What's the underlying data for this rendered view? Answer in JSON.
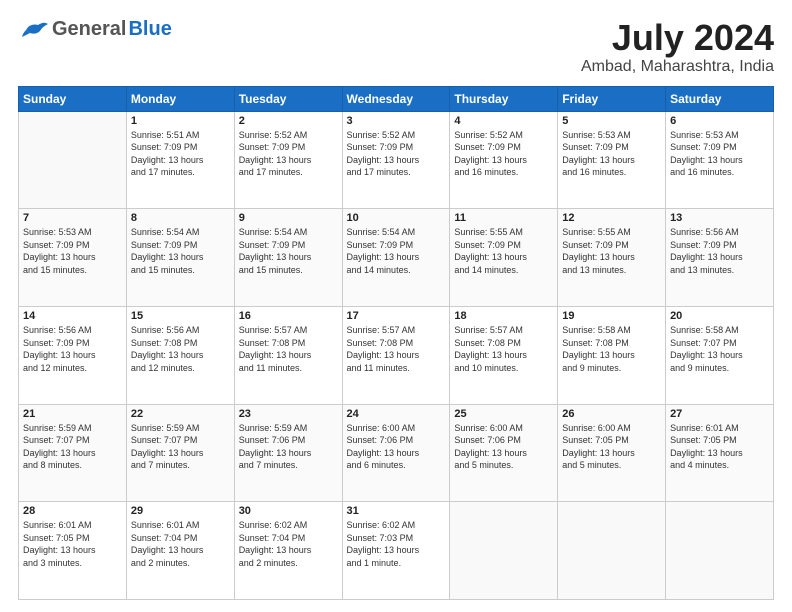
{
  "logo": {
    "general": "General",
    "blue": "Blue"
  },
  "header": {
    "month_year": "July 2024",
    "location": "Ambad, Maharashtra, India"
  },
  "days_of_week": [
    "Sunday",
    "Monday",
    "Tuesday",
    "Wednesday",
    "Thursday",
    "Friday",
    "Saturday"
  ],
  "weeks": [
    [
      {
        "day": "",
        "sunrise": "",
        "sunset": "",
        "daylight": ""
      },
      {
        "day": "1",
        "sunrise": "Sunrise: 5:51 AM",
        "sunset": "Sunset: 7:09 PM",
        "daylight": "Daylight: 13 hours and 17 minutes."
      },
      {
        "day": "2",
        "sunrise": "Sunrise: 5:52 AM",
        "sunset": "Sunset: 7:09 PM",
        "daylight": "Daylight: 13 hours and 17 minutes."
      },
      {
        "day": "3",
        "sunrise": "Sunrise: 5:52 AM",
        "sunset": "Sunset: 7:09 PM",
        "daylight": "Daylight: 13 hours and 17 minutes."
      },
      {
        "day": "4",
        "sunrise": "Sunrise: 5:52 AM",
        "sunset": "Sunset: 7:09 PM",
        "daylight": "Daylight: 13 hours and 16 minutes."
      },
      {
        "day": "5",
        "sunrise": "Sunrise: 5:53 AM",
        "sunset": "Sunset: 7:09 PM",
        "daylight": "Daylight: 13 hours and 16 minutes."
      },
      {
        "day": "6",
        "sunrise": "Sunrise: 5:53 AM",
        "sunset": "Sunset: 7:09 PM",
        "daylight": "Daylight: 13 hours and 16 minutes."
      }
    ],
    [
      {
        "day": "7",
        "sunrise": "Sunrise: 5:53 AM",
        "sunset": "Sunset: 7:09 PM",
        "daylight": "Daylight: 13 hours and 15 minutes."
      },
      {
        "day": "8",
        "sunrise": "Sunrise: 5:54 AM",
        "sunset": "Sunset: 7:09 PM",
        "daylight": "Daylight: 13 hours and 15 minutes."
      },
      {
        "day": "9",
        "sunrise": "Sunrise: 5:54 AM",
        "sunset": "Sunset: 7:09 PM",
        "daylight": "Daylight: 13 hours and 15 minutes."
      },
      {
        "day": "10",
        "sunrise": "Sunrise: 5:54 AM",
        "sunset": "Sunset: 7:09 PM",
        "daylight": "Daylight: 13 hours and 14 minutes."
      },
      {
        "day": "11",
        "sunrise": "Sunrise: 5:55 AM",
        "sunset": "Sunset: 7:09 PM",
        "daylight": "Daylight: 13 hours and 14 minutes."
      },
      {
        "day": "12",
        "sunrise": "Sunrise: 5:55 AM",
        "sunset": "Sunset: 7:09 PM",
        "daylight": "Daylight: 13 hours and 13 minutes."
      },
      {
        "day": "13",
        "sunrise": "Sunrise: 5:56 AM",
        "sunset": "Sunset: 7:09 PM",
        "daylight": "Daylight: 13 hours and 13 minutes."
      }
    ],
    [
      {
        "day": "14",
        "sunrise": "Sunrise: 5:56 AM",
        "sunset": "Sunset: 7:09 PM",
        "daylight": "Daylight: 13 hours and 12 minutes."
      },
      {
        "day": "15",
        "sunrise": "Sunrise: 5:56 AM",
        "sunset": "Sunset: 7:08 PM",
        "daylight": "Daylight: 13 hours and 12 minutes."
      },
      {
        "day": "16",
        "sunrise": "Sunrise: 5:57 AM",
        "sunset": "Sunset: 7:08 PM",
        "daylight": "Daylight: 13 hours and 11 minutes."
      },
      {
        "day": "17",
        "sunrise": "Sunrise: 5:57 AM",
        "sunset": "Sunset: 7:08 PM",
        "daylight": "Daylight: 13 hours and 11 minutes."
      },
      {
        "day": "18",
        "sunrise": "Sunrise: 5:57 AM",
        "sunset": "Sunset: 7:08 PM",
        "daylight": "Daylight: 13 hours and 10 minutes."
      },
      {
        "day": "19",
        "sunrise": "Sunrise: 5:58 AM",
        "sunset": "Sunset: 7:08 PM",
        "daylight": "Daylight: 13 hours and 9 minutes."
      },
      {
        "day": "20",
        "sunrise": "Sunrise: 5:58 AM",
        "sunset": "Sunset: 7:07 PM",
        "daylight": "Daylight: 13 hours and 9 minutes."
      }
    ],
    [
      {
        "day": "21",
        "sunrise": "Sunrise: 5:59 AM",
        "sunset": "Sunset: 7:07 PM",
        "daylight": "Daylight: 13 hours and 8 minutes."
      },
      {
        "day": "22",
        "sunrise": "Sunrise: 5:59 AM",
        "sunset": "Sunset: 7:07 PM",
        "daylight": "Daylight: 13 hours and 7 minutes."
      },
      {
        "day": "23",
        "sunrise": "Sunrise: 5:59 AM",
        "sunset": "Sunset: 7:06 PM",
        "daylight": "Daylight: 13 hours and 7 minutes."
      },
      {
        "day": "24",
        "sunrise": "Sunrise: 6:00 AM",
        "sunset": "Sunset: 7:06 PM",
        "daylight": "Daylight: 13 hours and 6 minutes."
      },
      {
        "day": "25",
        "sunrise": "Sunrise: 6:00 AM",
        "sunset": "Sunset: 7:06 PM",
        "daylight": "Daylight: 13 hours and 5 minutes."
      },
      {
        "day": "26",
        "sunrise": "Sunrise: 6:00 AM",
        "sunset": "Sunset: 7:05 PM",
        "daylight": "Daylight: 13 hours and 5 minutes."
      },
      {
        "day": "27",
        "sunrise": "Sunrise: 6:01 AM",
        "sunset": "Sunset: 7:05 PM",
        "daylight": "Daylight: 13 hours and 4 minutes."
      }
    ],
    [
      {
        "day": "28",
        "sunrise": "Sunrise: 6:01 AM",
        "sunset": "Sunset: 7:05 PM",
        "daylight": "Daylight: 13 hours and 3 minutes."
      },
      {
        "day": "29",
        "sunrise": "Sunrise: 6:01 AM",
        "sunset": "Sunset: 7:04 PM",
        "daylight": "Daylight: 13 hours and 2 minutes."
      },
      {
        "day": "30",
        "sunrise": "Sunrise: 6:02 AM",
        "sunset": "Sunset: 7:04 PM",
        "daylight": "Daylight: 13 hours and 2 minutes."
      },
      {
        "day": "31",
        "sunrise": "Sunrise: 6:02 AM",
        "sunset": "Sunset: 7:03 PM",
        "daylight": "Daylight: 13 hours and 1 minute."
      },
      {
        "day": "",
        "sunrise": "",
        "sunset": "",
        "daylight": ""
      },
      {
        "day": "",
        "sunrise": "",
        "sunset": "",
        "daylight": ""
      },
      {
        "day": "",
        "sunrise": "",
        "sunset": "",
        "daylight": ""
      }
    ]
  ]
}
